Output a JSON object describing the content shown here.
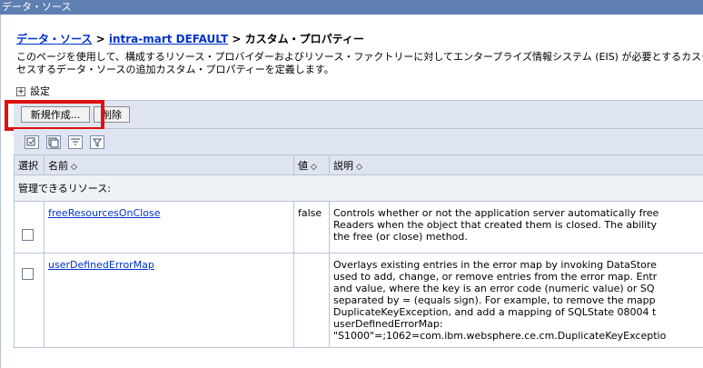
{
  "window_title": "データ・ソース",
  "breadcrumb": {
    "link1": "データ・ソース",
    "sep1": " > ",
    "link2": "intra-mart DEFAULT",
    "sep2": " > ",
    "current": "カスタム・プロパティー"
  },
  "description": {
    "line1": "このページを使用して、構成するリソース・プロバイダーおよびリソース・ファクトリーに対してエンタープライズ情報システム (EIS) が必要とするカスタム・",
    "line2": "セスするデータ・ソースの追加カスタム・プロパティーを定義します。"
  },
  "settings": {
    "plus": "+",
    "label": "設定"
  },
  "toolbar": {
    "new_label": "新規作成...",
    "delete_label": "削除"
  },
  "icons": [
    "select-all-icon",
    "deselect-all-icon",
    "filter-icon",
    "clear-filter-icon"
  ],
  "table": {
    "headers": {
      "select": "選択",
      "name": "名前",
      "value": "値",
      "desc": "説明",
      "sort": "◇"
    },
    "section": "管理できるリソース:",
    "rows": [
      {
        "name": "freeResourcesOnClose",
        "value": "false",
        "desc": [
          "Controls whether or not the application server automatically free",
          "Readers when the object that created them is closed. The ability",
          "the free (or close) method."
        ]
      },
      {
        "name": "userDefinedErrorMap",
        "value": "",
        "desc": [
          "Overlays existing entries in the error map by invoking DataStore",
          "used to add, change, or remove entries from the error map. Entr",
          "and value, where the key is an error code (numeric value) or SQ",
          "separated by = (equals sign). For example, to remove the mapp",
          "DuplicateKeyException, and add a mapping of SQLState 08004 t",
          "userDefinedErrorMap:",
          "\"S1000\"=;1062=com.ibm.websphere.ce.cm.DuplicateKeyExceptio"
        ]
      }
    ]
  },
  "colors": {
    "accent": "#5f7fb3",
    "highlight": "#e01010",
    "header_bg": "#dfe5f0"
  }
}
